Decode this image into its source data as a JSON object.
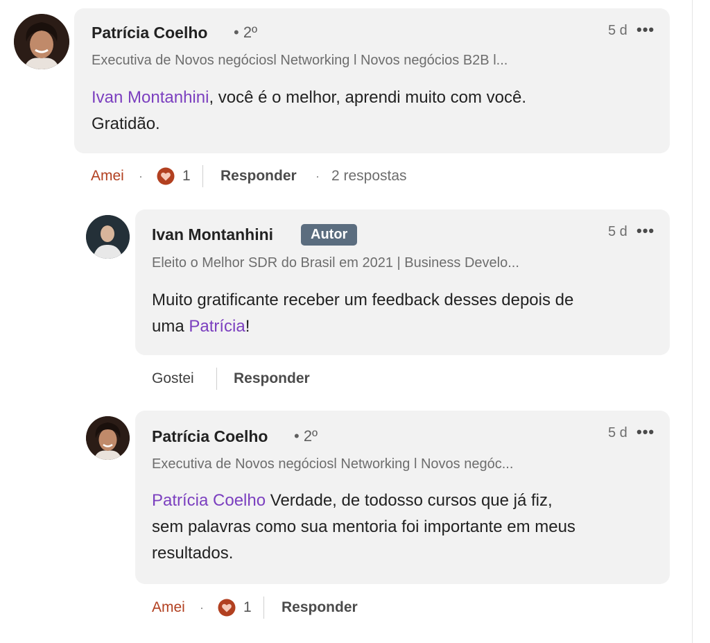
{
  "comments": [
    {
      "author": "Patrícia Coelho",
      "degree": "• 2º",
      "headline": "Executiva de Novos negóciosl Networking l Novos negócios B2B l...",
      "time": "5 d",
      "mention": "Ivan Montanhini",
      "text": ", você é o melhor, aprendi muito com você.",
      "text_line2": "Gratidão.",
      "reaction_label": "Amei",
      "reaction_count": "1",
      "reply_label": "Responder",
      "replies_count": "2 respostas"
    },
    {
      "author": "Ivan Montanhini",
      "badge": "Autor",
      "headline": "Eleito o Melhor SDR do Brasil em 2021 | Business Develo...",
      "time": "5 d",
      "text_line1": "Muito gratificante receber um feedback desses depois de",
      "text_pre": "uma ",
      "mention": "Patrícia",
      "text_post": "!",
      "like_label": "Gostei",
      "reply_label": "Responder"
    },
    {
      "author": "Patrícia Coelho",
      "degree": "• 2º",
      "headline": "Executiva de Novos negóciosl Networking l Novos negóc...",
      "time": "5 d",
      "mention": "Patrícia Coelho",
      "text": " Verdade, de todosso cursos que já fiz,",
      "text_line2": "sem palavras como sua mentoria foi importante em meus",
      "text_line3": "resultados.",
      "reaction_label": "Amei",
      "reaction_count": "1",
      "reply_label": "Responder"
    }
  ],
  "icons": {
    "more": "more-options-icon",
    "love": "heart-reaction-icon"
  },
  "colors": {
    "mention": "#7b3fbf",
    "reaction": "#b24020",
    "badge": "#5b6d7f",
    "bubble": "#f2f2f2"
  }
}
